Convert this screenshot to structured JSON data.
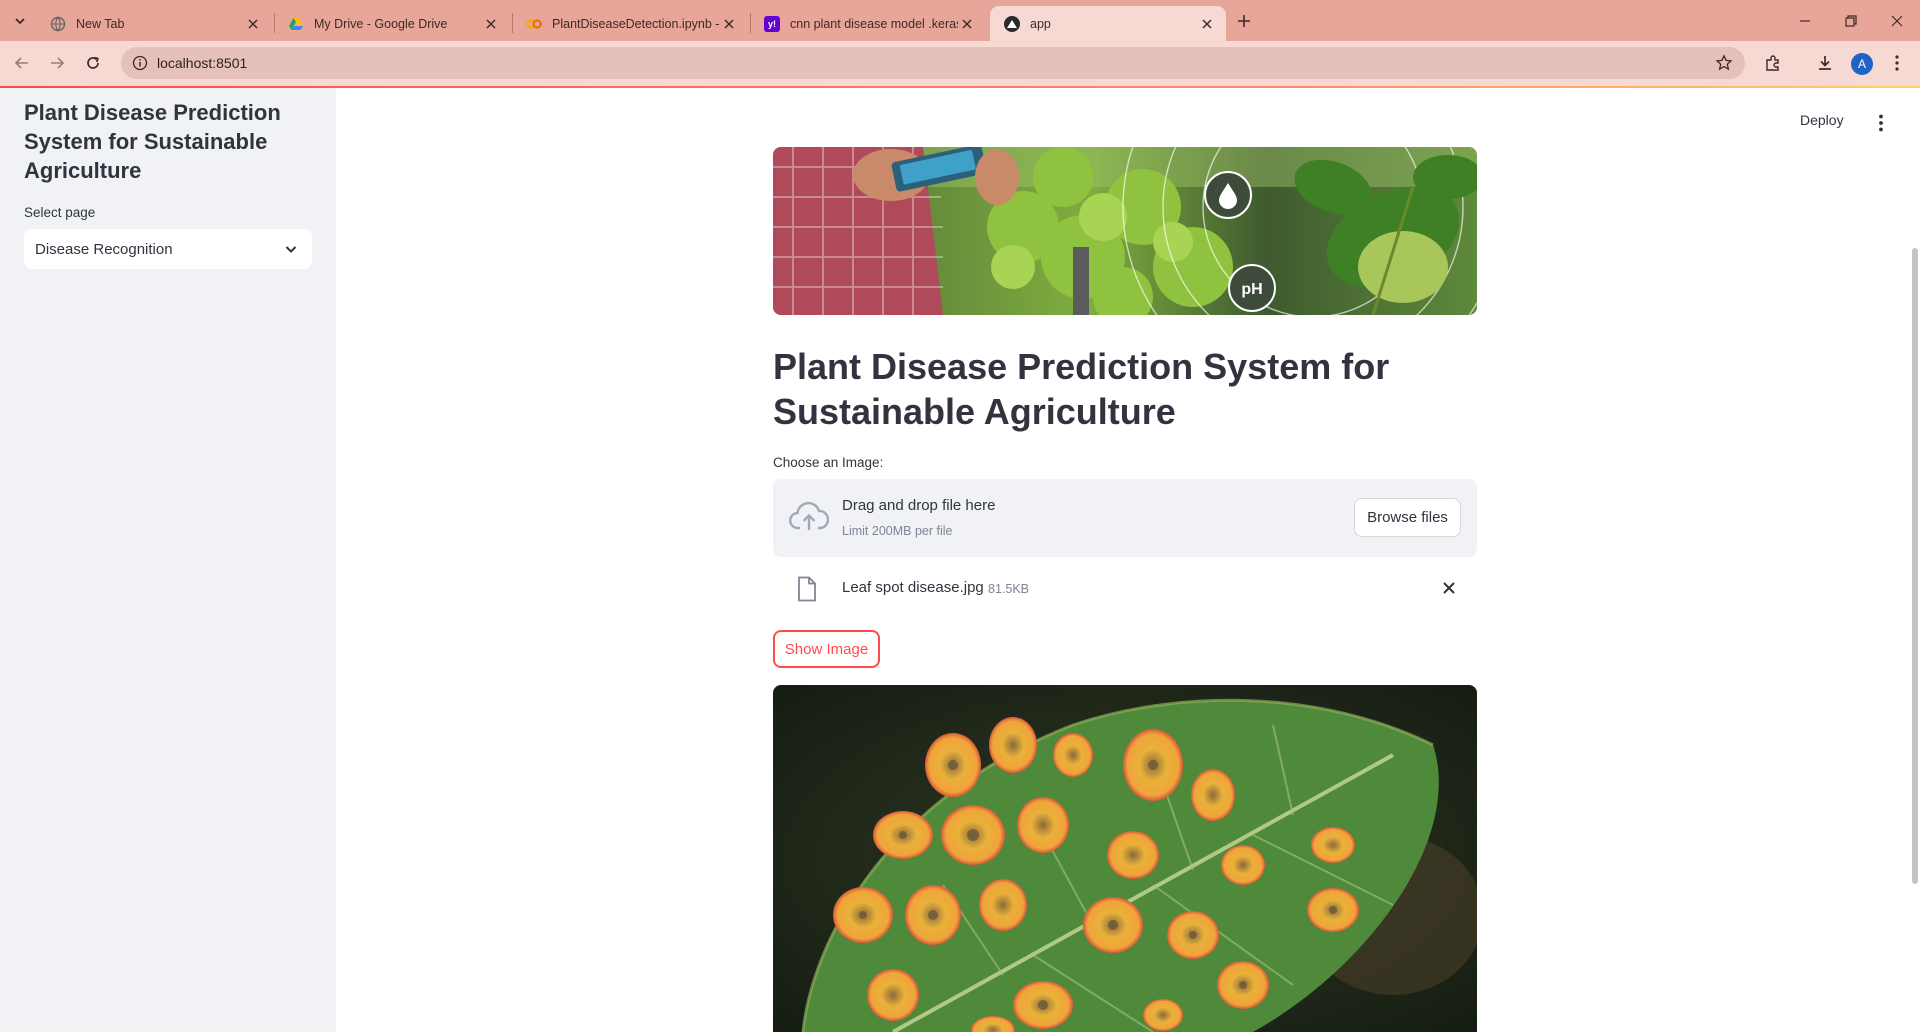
{
  "browser": {
    "tabs": [
      {
        "title": "New Tab",
        "favicon": "globe-icon",
        "color": "#5f6368"
      },
      {
        "title": "My Drive - Google Drive",
        "favicon": "google-drive-icon",
        "color": "#1fa463"
      },
      {
        "title": "PlantDiseaseDetection.ipynb - C",
        "favicon": "colab-icon",
        "color": "#f9ab00"
      },
      {
        "title": "cnn plant disease model .keras",
        "favicon": "yahoo-icon",
        "color": "#6001d2"
      },
      {
        "title": "app",
        "favicon": "streamlit-icon",
        "color": "#2a2a2a"
      }
    ],
    "active_tab": 4,
    "url": "localhost:8501",
    "profile_initial": "A"
  },
  "sidebar": {
    "title": "Plant Disease Prediction System for Sustainable Agriculture",
    "select_label": "Select page",
    "select_value": "Disease Recognition"
  },
  "header": {
    "deploy_label": "Deploy"
  },
  "main": {
    "hero_badge": "pH",
    "title": "Plant Disease Prediction System for Sustainable Agriculture",
    "uploader": {
      "label": "Choose an Image:",
      "drop_text": "Drag and drop file here",
      "limit_text": "Limit 200MB per file",
      "browse_label": "Browse files"
    },
    "uploaded_file": {
      "name": "Leaf spot disease.jpg",
      "size": "81.5KB"
    },
    "show_button_label": "Show Image"
  },
  "colors": {
    "accent": "#ff4b4b",
    "sidebar_bg": "#f0f2f6",
    "tabbar_bg": "#e8a69a",
    "toolbar_bg": "#f6d9d3"
  }
}
